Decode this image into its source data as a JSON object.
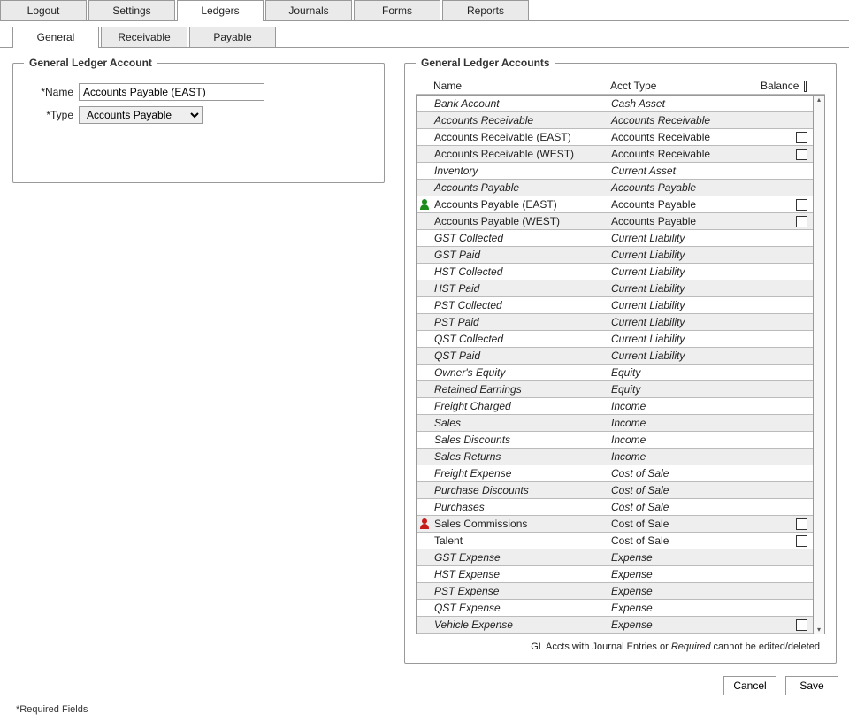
{
  "mainTabs": [
    "Logout",
    "Settings",
    "Ledgers",
    "Journals",
    "Forms",
    "Reports"
  ],
  "mainActive": 2,
  "subTabs": [
    "General",
    "Receivable",
    "Payable"
  ],
  "subActive": 0,
  "leftLegend": "General Ledger Account",
  "rightLegend": "General Ledger Accounts",
  "form": {
    "nameLabel": "Name",
    "nameValue": "Accounts Payable (EAST)",
    "typeLabel": "Type",
    "typeValue": "Accounts Payable"
  },
  "gridHeader": {
    "name": "Name",
    "type": "Acct Type",
    "balance": "Balance"
  },
  "rows": [
    {
      "name": "Bank Account",
      "type": "Cash Asset",
      "ico": "",
      "chk": false,
      "ital": true
    },
    {
      "name": "Accounts Receivable",
      "type": "Accounts Receivable",
      "ico": "",
      "chk": false,
      "ital": true
    },
    {
      "name": "Accounts Receivable (EAST)",
      "type": "Accounts Receivable",
      "ico": "",
      "chk": true,
      "ital": false
    },
    {
      "name": "Accounts Receivable (WEST)",
      "type": "Accounts Receivable",
      "ico": "",
      "chk": true,
      "ital": false
    },
    {
      "name": "Inventory",
      "type": "Current Asset",
      "ico": "",
      "chk": false,
      "ital": true
    },
    {
      "name": "Accounts Payable",
      "type": "Accounts Payable",
      "ico": "",
      "chk": false,
      "ital": true
    },
    {
      "name": "Accounts Payable (EAST)",
      "type": "Accounts Payable",
      "ico": "green",
      "chk": true,
      "ital": false
    },
    {
      "name": "Accounts Payable (WEST)",
      "type": "Accounts Payable",
      "ico": "",
      "chk": true,
      "ital": false
    },
    {
      "name": "GST Collected",
      "type": "Current Liability",
      "ico": "",
      "chk": false,
      "ital": true
    },
    {
      "name": "GST Paid",
      "type": "Current Liability",
      "ico": "",
      "chk": false,
      "ital": true
    },
    {
      "name": "HST Collected",
      "type": "Current Liability",
      "ico": "",
      "chk": false,
      "ital": true
    },
    {
      "name": "HST Paid",
      "type": "Current Liability",
      "ico": "",
      "chk": false,
      "ital": true
    },
    {
      "name": "PST Collected",
      "type": "Current Liability",
      "ico": "",
      "chk": false,
      "ital": true
    },
    {
      "name": "PST Paid",
      "type": "Current Liability",
      "ico": "",
      "chk": false,
      "ital": true
    },
    {
      "name": "QST Collected",
      "type": "Current Liability",
      "ico": "",
      "chk": false,
      "ital": true
    },
    {
      "name": "QST Paid",
      "type": "Current Liability",
      "ico": "",
      "chk": false,
      "ital": true
    },
    {
      "name": "Owner's Equity",
      "type": "Equity",
      "ico": "",
      "chk": false,
      "ital": true
    },
    {
      "name": "Retained Earnings",
      "type": "Equity",
      "ico": "",
      "chk": false,
      "ital": true
    },
    {
      "name": "Freight Charged",
      "type": "Income",
      "ico": "",
      "chk": false,
      "ital": true
    },
    {
      "name": "Sales",
      "type": "Income",
      "ico": "",
      "chk": false,
      "ital": true
    },
    {
      "name": "Sales Discounts",
      "type": "Income",
      "ico": "",
      "chk": false,
      "ital": true
    },
    {
      "name": "Sales Returns",
      "type": "Income",
      "ico": "",
      "chk": false,
      "ital": true
    },
    {
      "name": "Freight Expense",
      "type": "Cost of Sale",
      "ico": "",
      "chk": false,
      "ital": true
    },
    {
      "name": "Purchase Discounts",
      "type": "Cost of Sale",
      "ico": "",
      "chk": false,
      "ital": true
    },
    {
      "name": "Purchases",
      "type": "Cost of Sale",
      "ico": "",
      "chk": false,
      "ital": true
    },
    {
      "name": "Sales Commissions",
      "type": "Cost of Sale",
      "ico": "red",
      "chk": true,
      "ital": false
    },
    {
      "name": "Talent",
      "type": "Cost of Sale",
      "ico": "",
      "chk": true,
      "ital": false
    },
    {
      "name": "GST Expense",
      "type": "Expense",
      "ico": "",
      "chk": false,
      "ital": true
    },
    {
      "name": "HST Expense",
      "type": "Expense",
      "ico": "",
      "chk": false,
      "ital": true
    },
    {
      "name": "PST Expense",
      "type": "Expense",
      "ico": "",
      "chk": false,
      "ital": true
    },
    {
      "name": "QST Expense",
      "type": "Expense",
      "ico": "",
      "chk": false,
      "ital": true
    },
    {
      "name": "Vehicle Expense",
      "type": "Expense",
      "ico": "",
      "chk": true,
      "ital": true
    }
  ],
  "footnote_a": "GL Accts with Journal Entries or ",
  "footnote_it": "Required",
  "footnote_b": " cannot be edited/deleted",
  "buttons": {
    "cancel": "Cancel",
    "save": "Save"
  },
  "reqFields": "*Required Fields"
}
